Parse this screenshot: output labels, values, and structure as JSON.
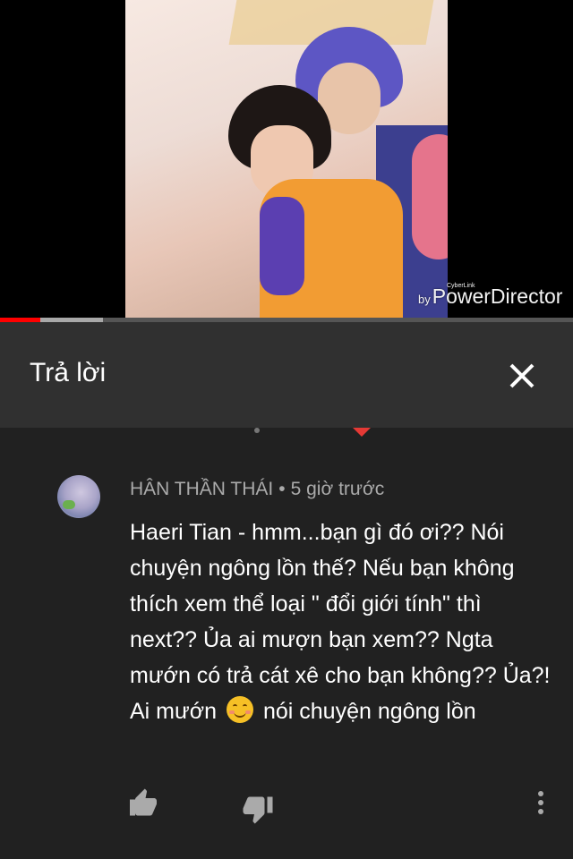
{
  "video": {
    "watermark_by": "by",
    "watermark_small": "CyberLink",
    "watermark_brand": "PowerDirector",
    "played_percent": 7,
    "buffered_percent": 18
  },
  "header": {
    "title": "Trả lời"
  },
  "comment": {
    "author": "HÂN THẦN THÁI",
    "separator": "•",
    "time": "5 giờ trước",
    "mention": "Haeri Tian -",
    "text_part1": "hmm...bạn gì đó ơi?? Nói chuyện ngông lồn thế? Nếu bạn không thích xem thể loại \" đổi giới tính\" thì next?? Ủa ai mượn bạn xem?? Ngta mướn có trả cát xê cho bạn không?? Ủa?! Ai mướn",
    "emoji_name": "smiling-face-icon",
    "text_part2": "nói chuyện ngông lồn"
  },
  "colors": {
    "background": "#212121",
    "header": "#303030",
    "progress_played": "#ff0000",
    "meta_text": "#aaaaaa"
  }
}
